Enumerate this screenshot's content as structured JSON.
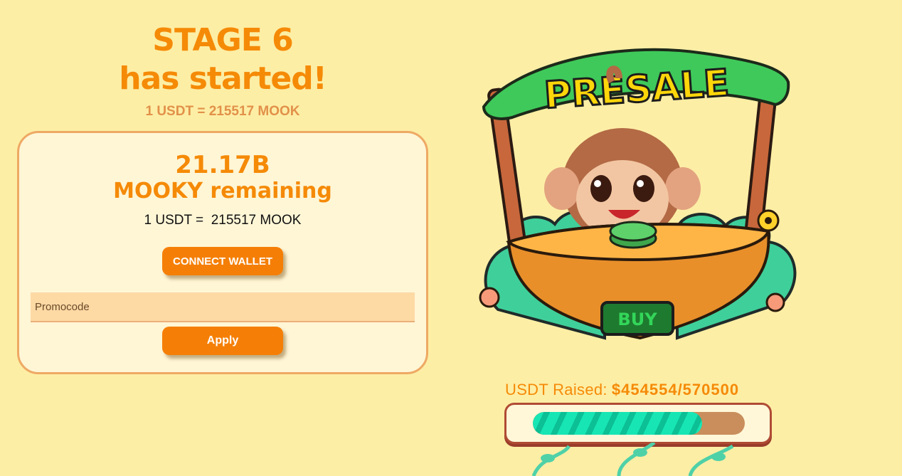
{
  "stage": {
    "line1": "STAGE 6",
    "line2": "has started!"
  },
  "rate_top": "1 USDT = 215517 MOOK",
  "card": {
    "remaining_amount": "21.17B",
    "remaining_label": "MOOKY remaining",
    "rate": "1 USDT =  215517 MOOK",
    "connect_label": "CONNECT WALLET",
    "promo_placeholder": "Promocode",
    "apply_label": "Apply"
  },
  "illustration": {
    "sign_text": "PRESALE",
    "buy_text": "BUY"
  },
  "raised": {
    "label": "USDT Raised:",
    "value": "$454554/570500",
    "progress": 0.797
  },
  "colors": {
    "background": "#fdeea5",
    "accent": "#f58a07",
    "progress": "#17e6b4"
  }
}
